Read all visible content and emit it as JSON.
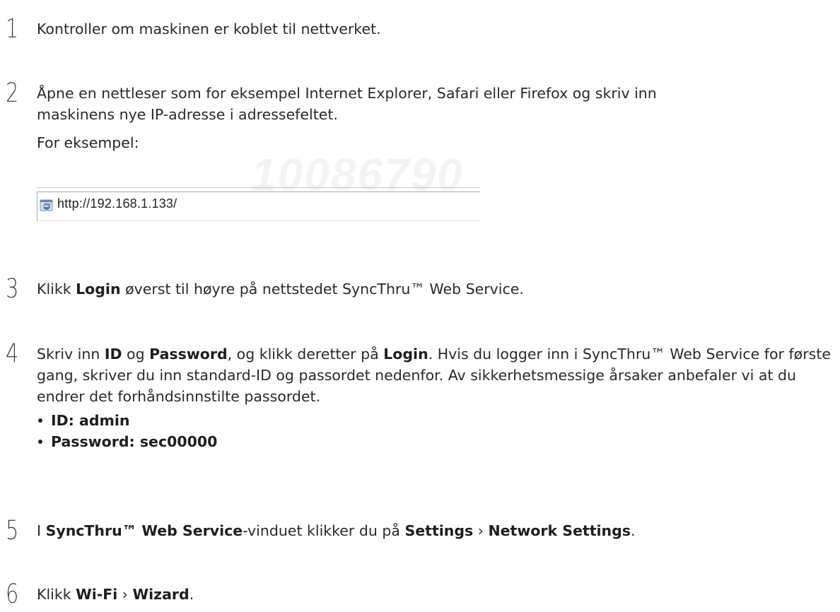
{
  "steps": [
    {
      "number": "1",
      "text": "Kontroller om maskinen er koblet til nettverket."
    },
    {
      "number": "2",
      "line1": "Åpne en nettleser som for eksempel Internet Explorer, Safari eller Firefox og skriv inn",
      "line2": "maskinens nye IP-adresse i adressefeltet.",
      "example_label": "For eksempel:",
      "address": "http://192.168.1.133/",
      "watermark": "10086790"
    },
    {
      "number": "3",
      "pre": "Klikk ",
      "b1": "Login",
      "post": " øverst til høyre på nettstedet SyncThru™ Web Service."
    },
    {
      "number": "4",
      "pre": "Skriv inn ",
      "b1": "ID",
      "mid1": " og ",
      "b2": "Password",
      "mid2": ", og klikk deretter på ",
      "b3": "Login",
      "post": ". Hvis du logger inn i SyncThru™ Web Service for første gang, skriver du inn standard-ID og passordet nedenfor. Av sikkerhetsmessige årsaker anbefaler vi at du endrer det forhåndsinnstilte passordet.",
      "bullets": [
        "ID: admin",
        "Password: sec00000"
      ]
    },
    {
      "number": "5",
      "pre": "I ",
      "b1": "SyncThru™ Web Service",
      "mid1": "-vinduet klikker du på ",
      "b2": "Settings",
      "sep": " › ",
      "b3": "Network Settings",
      "post": "."
    },
    {
      "number": "6",
      "pre": "Klikk ",
      "b1": "Wi-Fi",
      "sep": " › ",
      "b2": "Wizard",
      "post": "."
    }
  ],
  "icons": {
    "browser": "ie-browser-icon"
  }
}
